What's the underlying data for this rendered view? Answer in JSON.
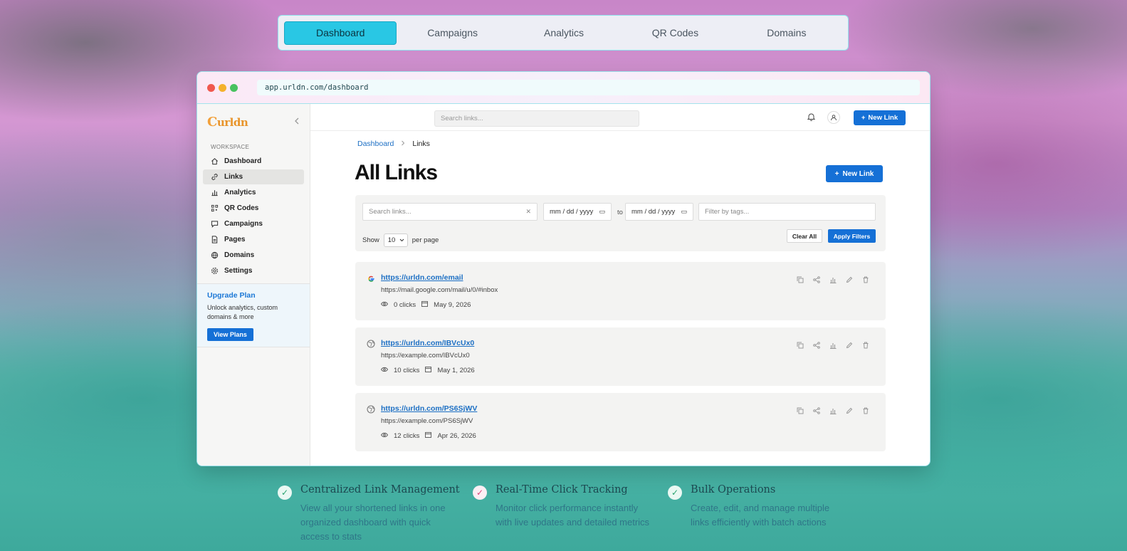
{
  "topnav": {
    "tabs": [
      {
        "label": "Dashboard",
        "active": true
      },
      {
        "label": "Campaigns",
        "active": false
      },
      {
        "label": "Analytics",
        "active": false
      },
      {
        "label": "QR Codes",
        "active": false
      },
      {
        "label": "Domains",
        "active": false
      }
    ]
  },
  "browser": {
    "url": "app.urldn.com/dashboard"
  },
  "sidebar": {
    "logo": "urldn",
    "logo_initial": "C",
    "section_label": "WORKSPACE",
    "items": [
      {
        "label": "Dashboard",
        "icon": "home-icon",
        "active": false
      },
      {
        "label": "Links",
        "icon": "link-icon",
        "active": true
      },
      {
        "label": "Analytics",
        "icon": "bar-chart-icon",
        "active": false
      },
      {
        "label": "QR Codes",
        "icon": "qr-code-icon",
        "active": false
      },
      {
        "label": "Campaigns",
        "icon": "campaign-icon",
        "active": false
      },
      {
        "label": "Pages",
        "icon": "page-icon",
        "active": false
      },
      {
        "label": "Domains",
        "icon": "globe-icon",
        "active": false
      },
      {
        "label": "Settings",
        "icon": "gear-icon",
        "active": false
      }
    ],
    "upgrade": {
      "title": "Upgrade Plan",
      "description": "Unlock analytics, custom domains & more",
      "button": "View Plans"
    }
  },
  "header": {
    "search_placeholder": "Search links...",
    "new_link": "New Link"
  },
  "breadcrumb": {
    "parent": "Dashboard",
    "current": "Links"
  },
  "page": {
    "title": "All Links",
    "new_link": "New Link"
  },
  "filters": {
    "search_placeholder": "Search links...",
    "date_from": "mm / dd / yyyy",
    "to_label": "to",
    "date_to": "mm / dd / yyyy",
    "tags_placeholder": "Filter by tags...",
    "show_label": "Show",
    "per_page_value": "10",
    "per_page_label": "per page",
    "clear": "Clear All",
    "apply": "Apply Filters"
  },
  "links": [
    {
      "short": "https://urldn.com/email",
      "long": "https://mail.google.com/mail/u/0/#inbox",
      "clicks": "0 clicks",
      "date": "May 9, 2026",
      "favicon": "google-icon"
    },
    {
      "short": "https://urldn.com/IBVcUx0",
      "long": "https://example.com/IBVcUx0",
      "clicks": "10 clicks",
      "date": "May 1, 2026",
      "favicon": "globe-icon"
    },
    {
      "short": "https://urldn.com/PS6SjWV",
      "long": "https://example.com/PS6SjWV",
      "clicks": "12 clicks",
      "date": "Apr 26, 2026",
      "favicon": "globe-icon"
    }
  ],
  "features": [
    {
      "title": "Centralized Link Management",
      "description": "View all your shortened links in one organized dashboard with quick access to stats"
    },
    {
      "title": "Real-Time Click Tracking",
      "description": "Monitor click performance instantly with live updates and detailed metrics"
    },
    {
      "title": "Bulk Operations",
      "description": "Create, edit, and manage multiple links efficiently with batch actions"
    }
  ],
  "colors": {
    "accent": "#1570d6",
    "tab_active": "#29c7e4",
    "link": "#1c6fc4"
  }
}
